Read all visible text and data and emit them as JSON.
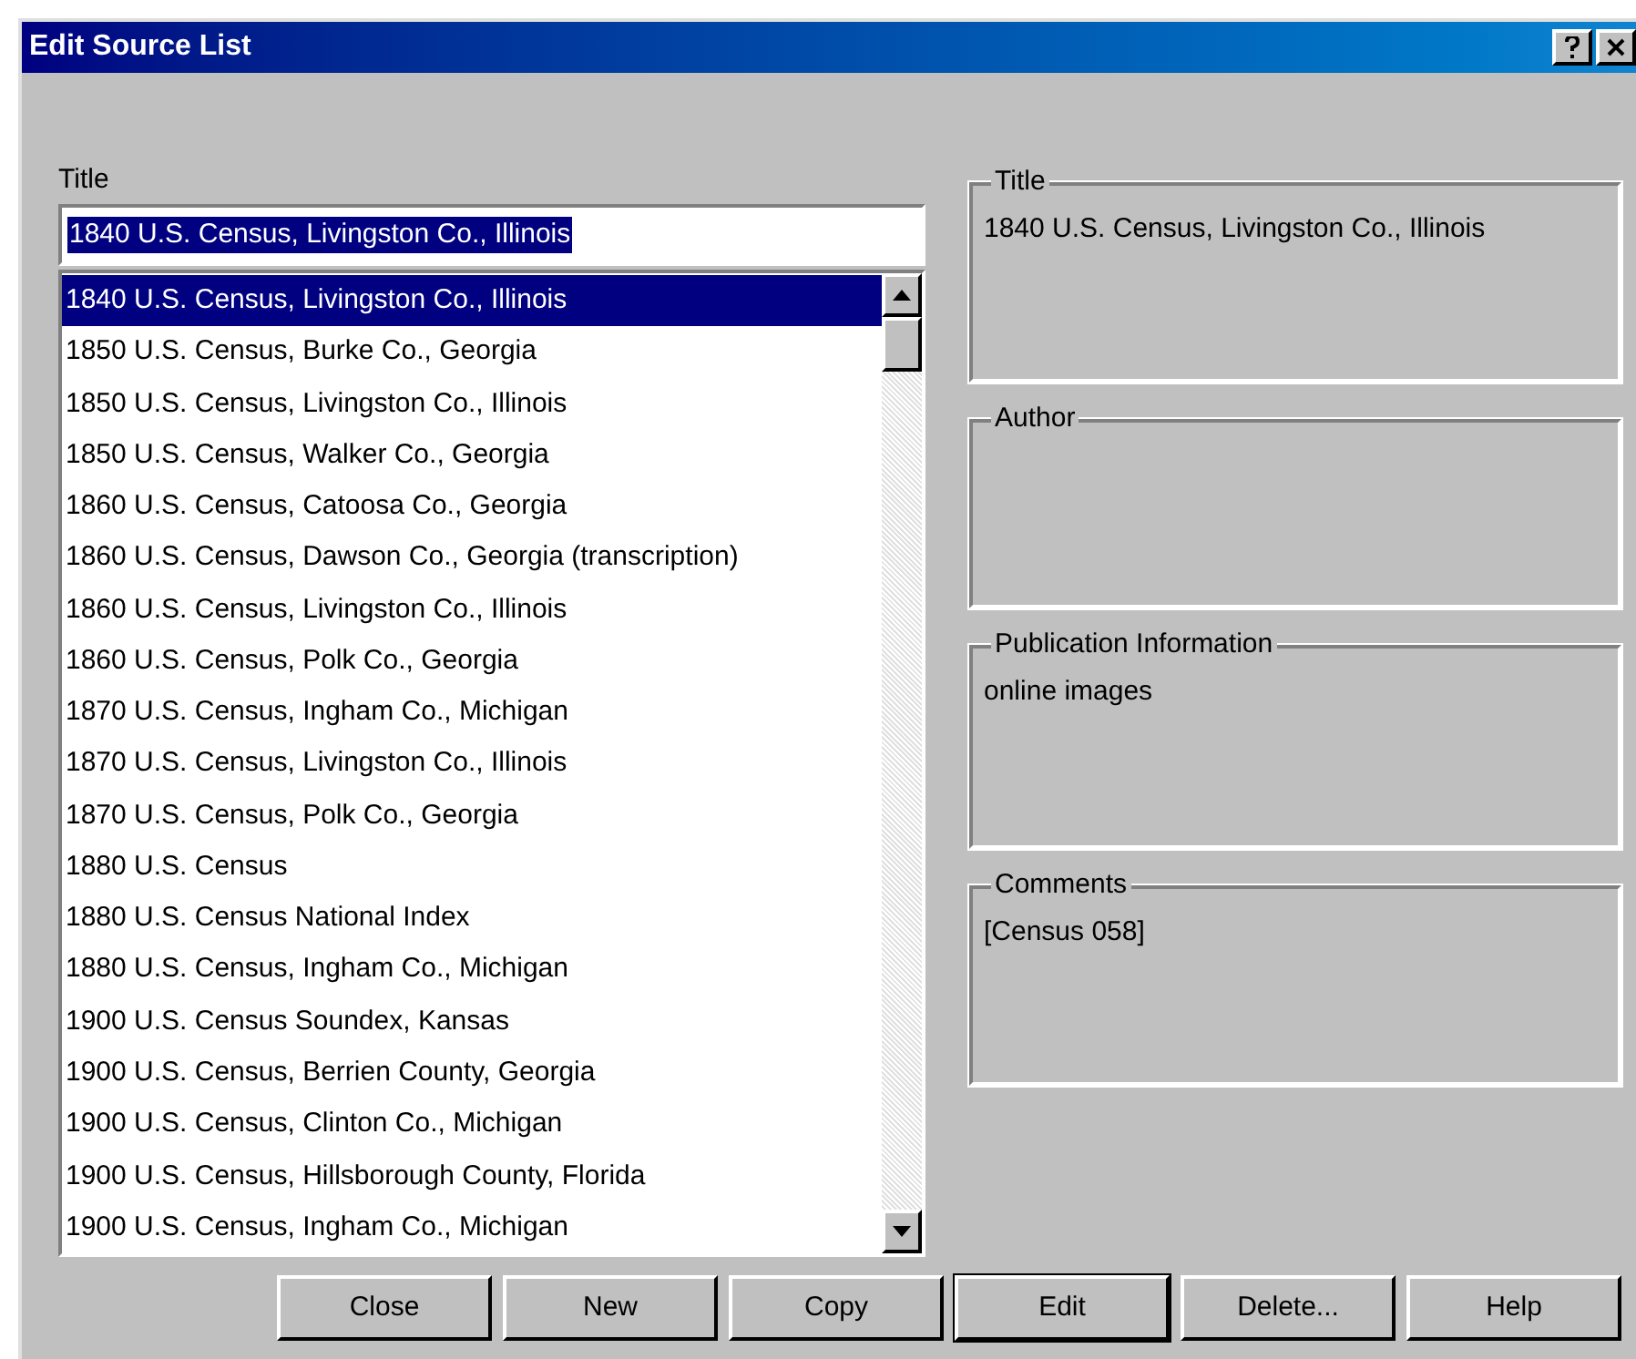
{
  "window": {
    "title": "Edit Source List"
  },
  "title_field": {
    "label": "Title",
    "value": "1840 U.S. Census, Livingston Co., Illinois"
  },
  "sources": [
    {
      "label": "1840 U.S. Census, Livingston Co., Illinois",
      "selected": true
    },
    {
      "label": "1850 U.S. Census, Burke Co., Georgia",
      "selected": false
    },
    {
      "label": "1850 U.S. Census, Livingston Co., Illinois",
      "selected": false
    },
    {
      "label": "1850 U.S. Census, Walker Co., Georgia",
      "selected": false
    },
    {
      "label": "1860 U.S. Census, Catoosa Co., Georgia",
      "selected": false
    },
    {
      "label": "1860 U.S. Census, Dawson Co., Georgia (transcription)",
      "selected": false
    },
    {
      "label": "1860 U.S. Census, Livingston Co., Illinois",
      "selected": false
    },
    {
      "label": "1860 U.S. Census, Polk Co., Georgia",
      "selected": false
    },
    {
      "label": "1870 U.S. Census, Ingham Co., Michigan",
      "selected": false
    },
    {
      "label": "1870 U.S. Census, Livingston Co., Illinois",
      "selected": false
    },
    {
      "label": "1870 U.S. Census, Polk Co., Georgia",
      "selected": false
    },
    {
      "label": "1880 U.S. Census",
      "selected": false
    },
    {
      "label": "1880 U.S. Census National Index",
      "selected": false
    },
    {
      "label": "1880 U.S. Census, Ingham Co., Michigan",
      "selected": false
    },
    {
      "label": "1900 U.S. Census Soundex, Kansas",
      "selected": false
    },
    {
      "label": "1900 U.S. Census, Berrien County, Georgia",
      "selected": false
    },
    {
      "label": "1900 U.S. Census, Clinton Co., Michigan",
      "selected": false
    },
    {
      "label": "1900 U.S. Census, Hillsborough County, Florida",
      "selected": false
    },
    {
      "label": "1900 U.S. Census, Ingham Co., Michigan",
      "selected": false
    }
  ],
  "details": [
    {
      "label": "Title",
      "value": "1840 U.S. Census, Livingston Co., Illinois"
    },
    {
      "label": "Author"
    },
    {
      "label": "Publication Information",
      "value": "online images"
    },
    {
      "label": "Comments",
      "value": "[Census 058]"
    }
  ],
  "buttons": [
    {
      "label": "Close",
      "default": false
    },
    {
      "label": "New",
      "default": false
    },
    {
      "label": "Copy",
      "default": false
    },
    {
      "label": "Edit",
      "default": true
    },
    {
      "label": "Delete...",
      "default": false
    },
    {
      "label": "Help",
      "default": false
    }
  ]
}
